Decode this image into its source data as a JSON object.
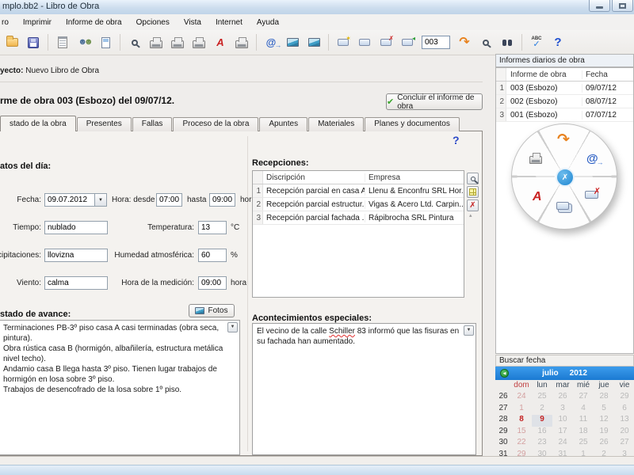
{
  "window": {
    "title": "mplo.bb2 - Libro de Obra",
    "controls": [
      "minimize",
      "maximize"
    ]
  },
  "menu": {
    "items": [
      {
        "label": "ro"
      },
      {
        "label": "Imprimir"
      },
      {
        "label": "Informe de obra"
      },
      {
        "label": "Opciones"
      },
      {
        "label": "Vista"
      },
      {
        "label": "Internet"
      },
      {
        "label": "Ayuda"
      }
    ]
  },
  "toolbar": {
    "report_number": "003",
    "icons": [
      "open-folder",
      "save",
      "report",
      "people",
      "document",
      "print-preview",
      "printer",
      "printer",
      "printer",
      "pdf-export",
      "print-setup",
      "email",
      "image-import",
      "image",
      "window-new",
      "window",
      "window-delete",
      "window-insert",
      "go-arrow",
      "date-search",
      "binoculars-search",
      "spellcheck",
      "help"
    ]
  },
  "project": {
    "label": "yecto:",
    "value": "Nuevo Libro de Obra"
  },
  "report": {
    "title": "rme de obra 003 (Esbozo) del 09/07/12.",
    "conclude_label": "Concluir el informe de obra"
  },
  "tabs": {
    "active": "stado de la obra",
    "items": [
      "stado de la obra",
      "Presentes",
      "Fallas",
      "Proceso de la obra",
      "Apuntes",
      "Materiales",
      "Planes y documentos"
    ]
  },
  "help_glyph": "?",
  "datos": {
    "section_label": "atos del día:",
    "fecha_label": "Fecha:",
    "fecha_value": "09.07.2012",
    "hora_desde_label": "Hora: desde",
    "hora_desde": "07:00",
    "hasta_label": "hasta",
    "hora_hasta": "09:00",
    "hora_unit": "hora",
    "tiempo_label": "Tiempo:",
    "tiempo_value": "nublado",
    "temperatura_label": "Temperatura:",
    "temperatura_value": "13",
    "temperatura_unit": "°C",
    "precipitaciones_label": "recipitaciones:",
    "precipitaciones_value": "llovizna",
    "humedad_label": "Humedad atmosférica:",
    "humedad_value": "60",
    "humedad_unit": "%",
    "viento_label": "Viento:",
    "viento_value": "calma",
    "medicion_label": "Hora de la medición:",
    "medicion_value": "09:00",
    "medicion_unit": "hora"
  },
  "recepciones": {
    "label": "Recepciones:",
    "columns": [
      "Discripción",
      "Empresa"
    ],
    "rows": [
      {
        "num": "1",
        "descripcion": "Recepción parcial en casa A",
        "empresa": "Llenu & Enconfru SRL  Hor..."
      },
      {
        "num": "2",
        "descripcion": "Recepción parcial estructur...",
        "empresa": "Vigas & Acero Ltd.  Carpin..."
      },
      {
        "num": "3",
        "descripcion": "Recepción parcial fachada ...",
        "empresa": "Rápibrocha SRL  Pintura"
      }
    ],
    "side_icons": [
      "zoom",
      "add-row",
      "delete-row"
    ]
  },
  "estado": {
    "label": "stado de avance:",
    "fotos_label": "Fotos",
    "lines": [
      "Terminaciones PB-3º piso casa A casi terminadas (obra seca, pintura).",
      "Obra rústica casa B (hormigón, albañilería, estructura metálica nivel techo).",
      "Andamio casa B llega hasta 3º piso. Tienen lugar trabajos de hormigón en losa sobre 3º piso.",
      "Trabajos de desencofrado de la losa sobre 1º piso."
    ]
  },
  "acontecimientos": {
    "label": "Acontecimientos especiales:",
    "text_before": "El vecino de la calle ",
    "highlight_word": "Schiller",
    "text_after": " 83 informó que las fisuras en su fachada han aumentado."
  },
  "informes": {
    "title": "Informes diarios de obra",
    "columns": [
      "Informe de obra",
      "Fecha"
    ],
    "rows": [
      {
        "num": "1",
        "informe": "003 (Esbozo)",
        "fecha": "09/07/12"
      },
      {
        "num": "2",
        "informe": "002 (Esbozo)",
        "fecha": "08/07/12"
      },
      {
        "num": "3",
        "informe": "001 (Esbozo)",
        "fecha": "07/07/12"
      }
    ]
  },
  "wheel": {
    "icons": [
      "printer",
      "go-arrow",
      "email",
      "delete-report",
      "reports-stack",
      "pdf-export"
    ],
    "center_icon": "close"
  },
  "calendar": {
    "search_label": "Buscar fecha",
    "month": "julio",
    "year": "2012",
    "day_headers": [
      "dom",
      "lun",
      "mar",
      "mié",
      "jue",
      "vie"
    ],
    "week_numbers": [
      "26",
      "27",
      "28",
      "29",
      "30",
      "31"
    ],
    "weeks": [
      [
        "24",
        "25",
        "26",
        "27",
        "28",
        "29"
      ],
      [
        "1",
        "2",
        "3",
        "4",
        "5",
        "6"
      ],
      [
        "8",
        "9",
        "10",
        "11",
        "12",
        "13"
      ],
      [
        "15",
        "16",
        "17",
        "18",
        "19",
        "20"
      ],
      [
        "22",
        "23",
        "24",
        "25",
        "26",
        "27"
      ],
      [
        "29",
        "30",
        "31",
        "1",
        "2",
        "3"
      ]
    ],
    "red_days": [
      [
        2,
        0
      ],
      [
        2,
        1
      ]
    ],
    "selected_day": [
      2,
      1
    ]
  },
  "colors": {
    "calendar_blue": "#2b8ee0",
    "holiday_red": "#c42222",
    "check_green": "#3aa42a",
    "accent_orange": "#e8821e"
  }
}
